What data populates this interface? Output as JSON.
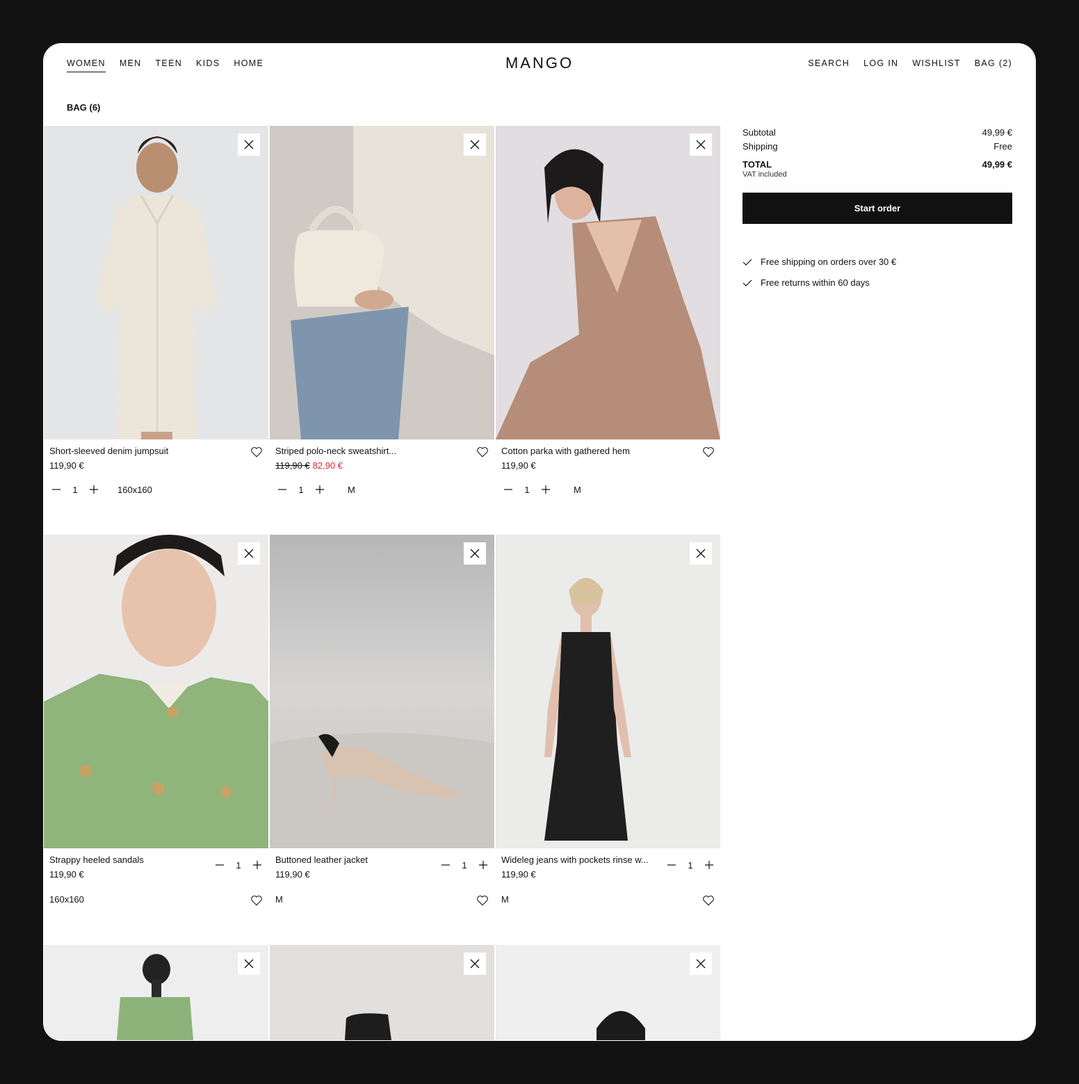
{
  "header": {
    "nav_left": [
      "WOMEN",
      "MEN",
      "TEEN",
      "KIDS",
      "HOME"
    ],
    "logo": "MANGO",
    "nav_right": [
      "SEARCH",
      "LOG IN",
      "WISHLIST",
      "BAG (2)"
    ]
  },
  "page_title": "BAG (6)",
  "products": [
    {
      "name": "Short-sleeved denim jumpsuit",
      "price": "119,90 €",
      "qty": "1",
      "size": "160x160"
    },
    {
      "name": "Striped polo-neck sweatshirt...",
      "old_price": "119,90 €",
      "sale_price": "82,90 €",
      "qty": "1",
      "size": "M"
    },
    {
      "name": "Cotton parka with gathered hem",
      "price": "119,90 €",
      "qty": "1",
      "size": "M"
    },
    {
      "name": "Strappy heeled sandals",
      "price": "119,90 €",
      "qty": "1",
      "size": "160x160"
    },
    {
      "name": "Buttoned leather jacket",
      "price": "119,90 €",
      "qty": "1",
      "size": "M"
    },
    {
      "name": "Wideleg jeans with pockets rinse w...",
      "price": "119,90 €",
      "qty": "1",
      "size": "M"
    }
  ],
  "summary": {
    "subtotal_label": "Subtotal",
    "subtotal_value": "49,99 €",
    "shipping_label": "Shipping",
    "shipping_value": "Free",
    "total_label": "TOTAL",
    "total_value": "49,99 €",
    "vat_note": "VAT included",
    "start_button": "Start order",
    "perks": [
      "Free shipping on orders over 30 €",
      "Free returns within 60 days"
    ]
  },
  "colors": {
    "accent": "#111111",
    "sale": "#e0262c",
    "background": "#121212"
  }
}
